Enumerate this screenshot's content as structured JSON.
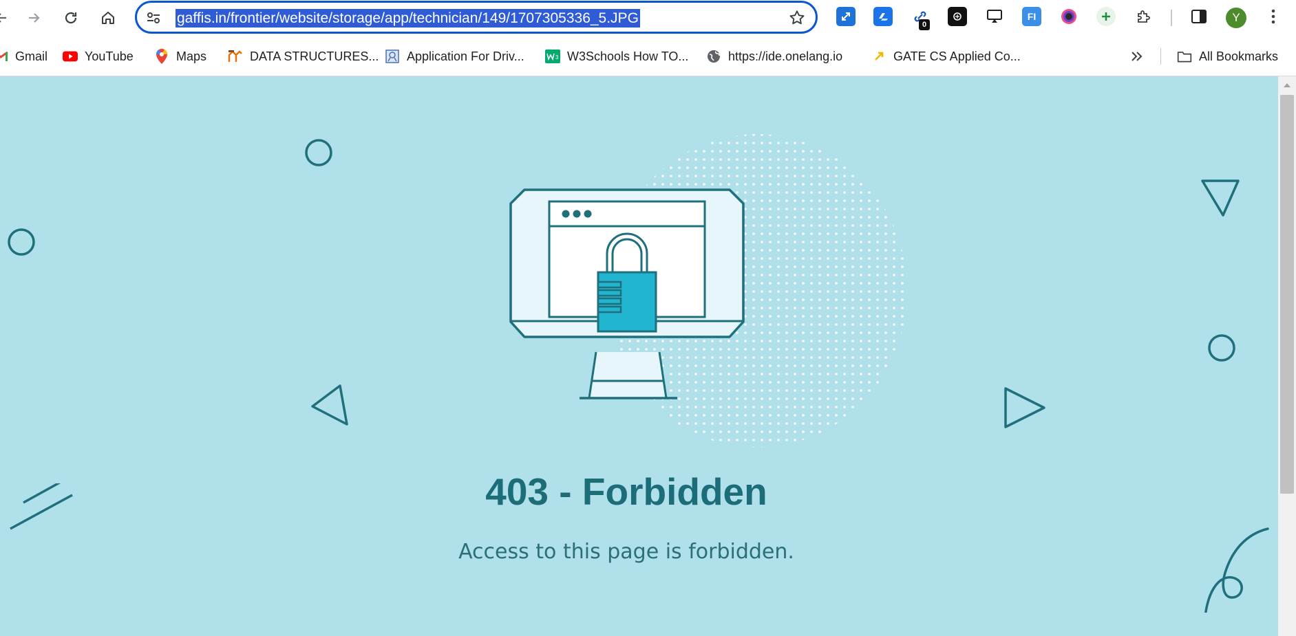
{
  "browser": {
    "url": "gaffis.in/frontier/website/storage/app/technician/149/1707305336_5.JPG",
    "extension_badge": "0",
    "profile_initial": "Y"
  },
  "bookmarks": {
    "items": [
      {
        "label": "Gmail",
        "icon": "gmail-icon"
      },
      {
        "label": "YouTube",
        "icon": "youtube-icon"
      },
      {
        "label": "Maps",
        "icon": "maps-icon"
      },
      {
        "label": "DATA STRUCTURES...",
        "icon": "bookmark-site-icon"
      },
      {
        "label": "Application For Driv...",
        "icon": "bookmark-site-icon"
      },
      {
        "label": "W3Schools How TO...",
        "icon": "w3schools-icon"
      },
      {
        "label": "https://ide.onelang.io",
        "icon": "globe-icon"
      },
      {
        "label": "GATE CS Applied Co...",
        "icon": "bookmark-site-icon"
      }
    ],
    "all_bookmarks": "All Bookmarks"
  },
  "page": {
    "title": "403 - Forbidden",
    "message": "Access to this page is forbidden."
  },
  "colors": {
    "background": "#b0e0e9",
    "accent": "#1d6d79",
    "lock": "#22b5cf",
    "url_highlight": "#2f5cd6"
  }
}
